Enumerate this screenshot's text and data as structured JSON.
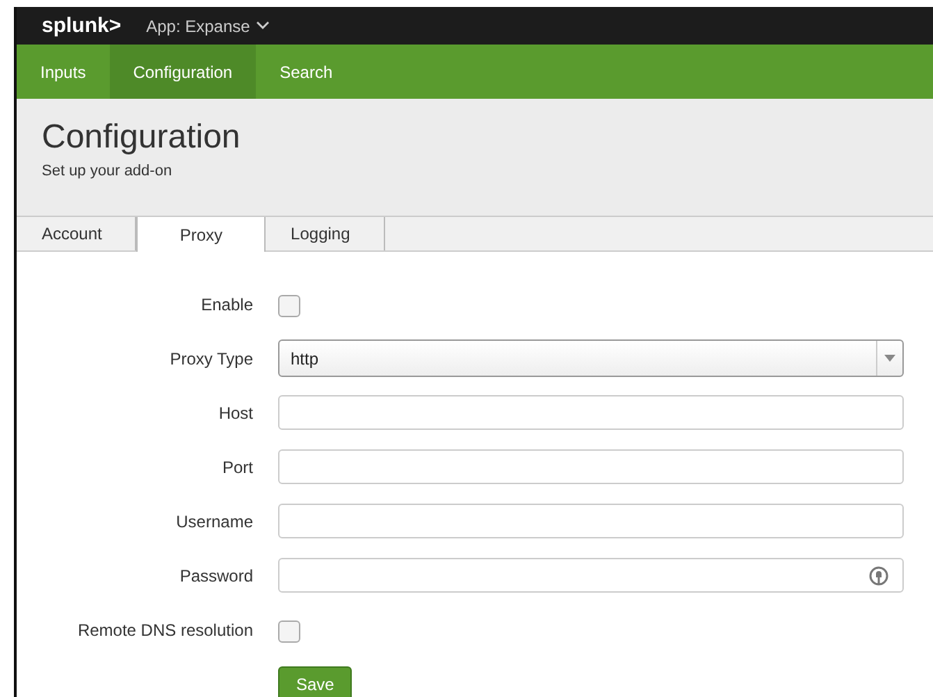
{
  "top_bar": {
    "logo": "splunk>",
    "app_menu": "App: Expanse"
  },
  "nav": [
    {
      "label": "Inputs",
      "selected": false
    },
    {
      "label": "Configuration",
      "selected": true
    },
    {
      "label": "Search",
      "selected": false
    }
  ],
  "header": {
    "title": "Configuration",
    "subtitle": "Set up your add-on"
  },
  "tabs": [
    {
      "label": "Account",
      "selected": false
    },
    {
      "label": "Proxy",
      "selected": true
    },
    {
      "label": "Logging",
      "selected": false
    }
  ],
  "form": [
    {
      "kind": "checkbox",
      "label": "Enable",
      "checked": false
    },
    {
      "kind": "select",
      "label": "Proxy Type",
      "value": "http"
    },
    {
      "kind": "text",
      "label": "Host"
    },
    {
      "kind": "text",
      "label": "Port"
    },
    {
      "kind": "text",
      "label": "Username"
    },
    {
      "kind": "password",
      "label": "Password"
    },
    {
      "kind": "checkbox",
      "label": "Remote DNS resolution",
      "checked": false
    }
  ],
  "save_button": "Save"
}
